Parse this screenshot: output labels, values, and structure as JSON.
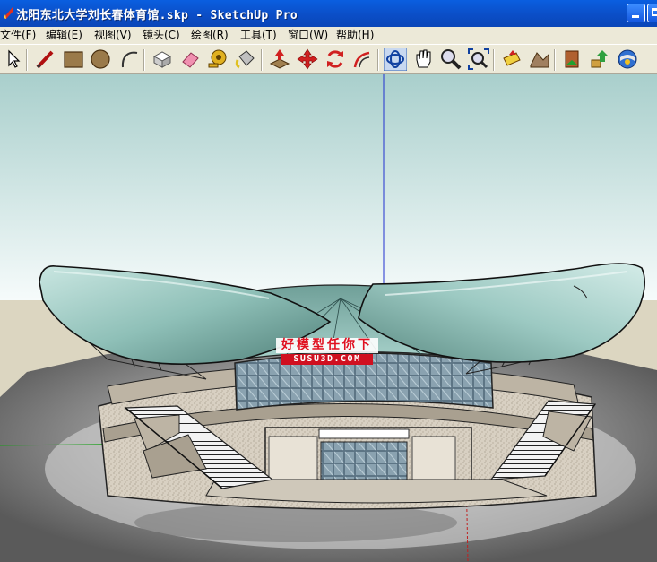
{
  "window": {
    "title": "沈阳东北大学刘长春体育馆.skp - SketchUp Pro"
  },
  "menu": [
    {
      "label": "文件(F)",
      "name": "menu-file"
    },
    {
      "label": "编辑(E)",
      "name": "menu-edit"
    },
    {
      "label": "视图(V)",
      "name": "menu-view"
    },
    {
      "label": "镜头(C)",
      "name": "menu-camera"
    },
    {
      "label": "绘图(R)",
      "name": "menu-draw"
    },
    {
      "label": "工具(T)",
      "name": "menu-tools"
    },
    {
      "label": "窗口(W)",
      "name": "menu-window"
    },
    {
      "label": "帮助(H)",
      "name": "menu-help"
    }
  ],
  "toolbar": {
    "tools": [
      "select-icon",
      "pencil-icon",
      "rectangle-icon",
      "circle-icon",
      "arc-icon",
      "make-component-icon",
      "eraser-icon",
      "tape-measure-icon",
      "paint-bucket-icon",
      "push-pull-icon",
      "move-icon",
      "rotate-icon",
      "offset-icon",
      "orbit-icon",
      "pan-icon",
      "zoom-icon",
      "zoom-extents-icon",
      "add-location-icon",
      "toggle-terrain-icon",
      "get-models-icon",
      "share-model-icon",
      "get-photo-texture-icon"
    ]
  },
  "watermark": {
    "main": "好模型任你下",
    "sub": "SUSU3D.COM"
  },
  "colors": {
    "title_bar": "#0b4ec7",
    "chrome": "#ece9d8",
    "sky_top": "#a9cfcc",
    "ground": "#dcd6c1",
    "blue_axis": "#2030d0",
    "green_axis": "#18a018",
    "red_axis": "#c02020",
    "roof": "#8fc0b8",
    "watermark_red": "#e01020"
  }
}
